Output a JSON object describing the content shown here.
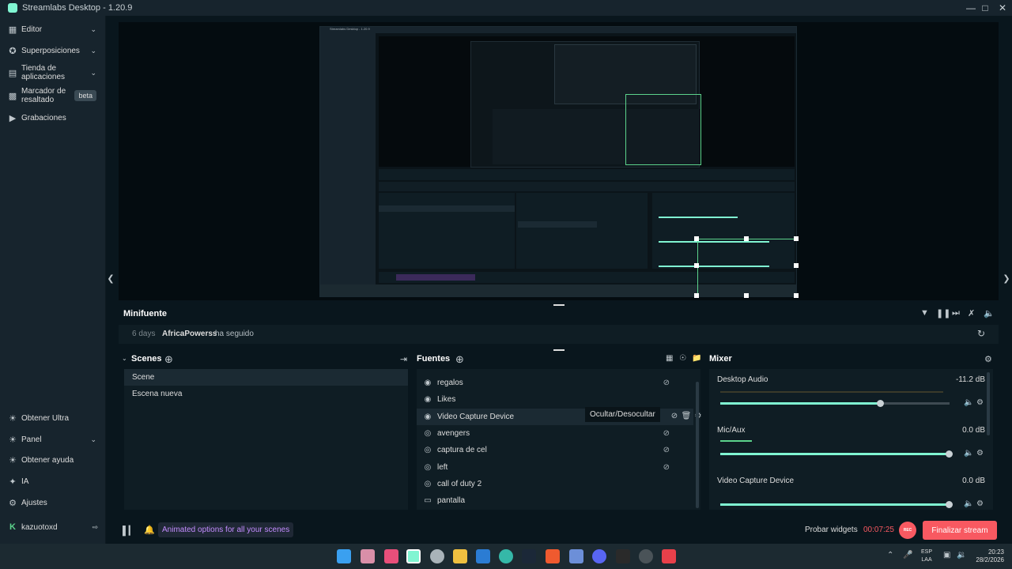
{
  "window": {
    "title": "Streamlabs Desktop - 1.20.9"
  },
  "sidebar": {
    "top_items": [
      {
        "label": "Editor",
        "icon": "editor-icon"
      },
      {
        "label": "Superposiciones",
        "icon": "overlays-icon"
      },
      {
        "label": "Tienda de aplicaciones",
        "icon": "app-store-icon"
      },
      {
        "label": "Marcador de resaltado",
        "icon": "highlighter-icon",
        "badge": "beta"
      },
      {
        "label": "Grabaciones",
        "icon": "recordings-icon"
      }
    ],
    "bottom_items": [
      {
        "label": "Obtener Ultra",
        "icon": "ultra-icon"
      },
      {
        "label": "Panel",
        "icon": "dashboard-icon"
      },
      {
        "label": "Obtener ayuda",
        "icon": "help-icon"
      },
      {
        "label": "IA",
        "icon": "ai-icon"
      },
      {
        "label": "Ajustes",
        "icon": "settings-icon"
      }
    ],
    "user": {
      "name": "kazuotoxd"
    }
  },
  "preview": {
    "nested_title": "Streamlabs Desktop - 1.20.9"
  },
  "minifuente": {
    "title": "Minifuente",
    "event": {
      "time": "6 days",
      "user": "AfricaPowerss",
      "action": "ha seguido"
    }
  },
  "scenes": {
    "title": "Scenes",
    "items": [
      {
        "label": "Scene",
        "active": true
      },
      {
        "label": "Escena nueva",
        "active": false
      }
    ]
  },
  "sources": {
    "title": "Fuentes",
    "tooltip": "Ocultar/Desocultar",
    "items": [
      {
        "label": "regalos",
        "icon": "globe-icon"
      },
      {
        "label": "Likes",
        "icon": "globe-icon"
      },
      {
        "label": "Video Capture Device",
        "icon": "webcam-icon",
        "active": true
      },
      {
        "label": "avengers",
        "icon": "game-capture-icon"
      },
      {
        "label": "captura de cel",
        "icon": "game-capture-icon"
      },
      {
        "label": "left",
        "icon": "game-capture-icon"
      },
      {
        "label": "call of duty 2",
        "icon": "game-capture-icon"
      },
      {
        "label": "pantalla",
        "icon": "display-icon"
      }
    ]
  },
  "mixer": {
    "title": "Mixer",
    "tracks": [
      {
        "name": "Desktop Audio",
        "db": "-11.2 dB",
        "level": 0.7
      },
      {
        "name": "Mic/Aux",
        "db": "0.0 dB",
        "level": 1.0
      },
      {
        "name": "Video Capture Device",
        "db": "0.0 dB",
        "level": 1.0
      }
    ]
  },
  "footer": {
    "promo": "Animated options for all your scenes",
    "test_widgets": "Probar widgets",
    "timer": "00:07:25",
    "rec": "REC",
    "end_stream": "Finalizar stream"
  },
  "taskbar": {
    "lang": "ESP",
    "lang_sub": "LAA",
    "time": "20:23",
    "date": "28/2/2026"
  },
  "colors": {
    "accent": "#80f5d2",
    "danger": "#f85961",
    "panel": "#0f1d24",
    "sidebar": "#17242d"
  }
}
